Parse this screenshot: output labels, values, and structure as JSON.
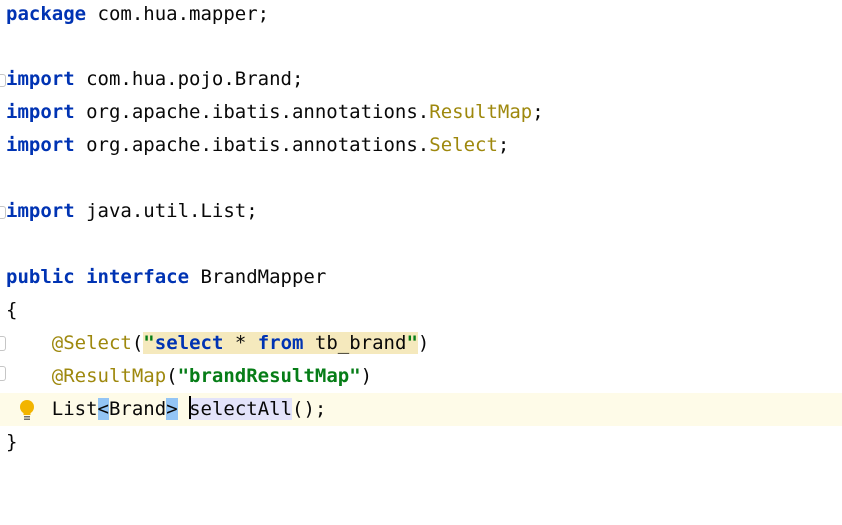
{
  "code": {
    "line1": {
      "kw": "package",
      "rest": " com.hua.mapper;"
    },
    "line3": {
      "kw": "import",
      "rest": " com.hua.pojo.Brand;"
    },
    "line4": {
      "kw": "import",
      "rest": " org.apache.ibatis.annotations.",
      "cls": "ResultMap",
      "end": ";"
    },
    "line5": {
      "kw": "import",
      "rest": " org.apache.ibatis.annotations.",
      "cls": "Select",
      "end": ";"
    },
    "line7": {
      "kw": "import",
      "rest": " java.util.List;"
    },
    "line9": {
      "kw1": "public",
      "kw2": "interface",
      "name": " BrandMapper"
    },
    "line10": {
      "text": "{"
    },
    "line11": {
      "indent": "    ",
      "ann": "@Select",
      "open": "(",
      "q1": "\"",
      "s1": "select",
      "s2": " * ",
      "s3": "from",
      "s4": " tb_brand",
      "q2": "\"",
      "close": ")"
    },
    "line12": {
      "indent": "    ",
      "ann": "@ResultMap",
      "open": "(",
      "str": "\"brandResultMap\"",
      "close": ")"
    },
    "line13": {
      "indent": "    ",
      "type": "List",
      "lt": "<",
      "generic": "Brand",
      "gt": ">",
      "sp": " ",
      "method": "selectAll",
      "end": "();"
    },
    "line14": {
      "text": "}"
    }
  },
  "icons": {
    "intention_bulb": "lightbulb-icon",
    "fold": "fold-marker-icon"
  },
  "colors": {
    "keyword": "#0033b3",
    "annotation": "#9e880d",
    "string": "#067d17",
    "current_line": "#fefbe8",
    "string_highlight": "#f5e9bd",
    "brace_match": "#93c5f5"
  }
}
